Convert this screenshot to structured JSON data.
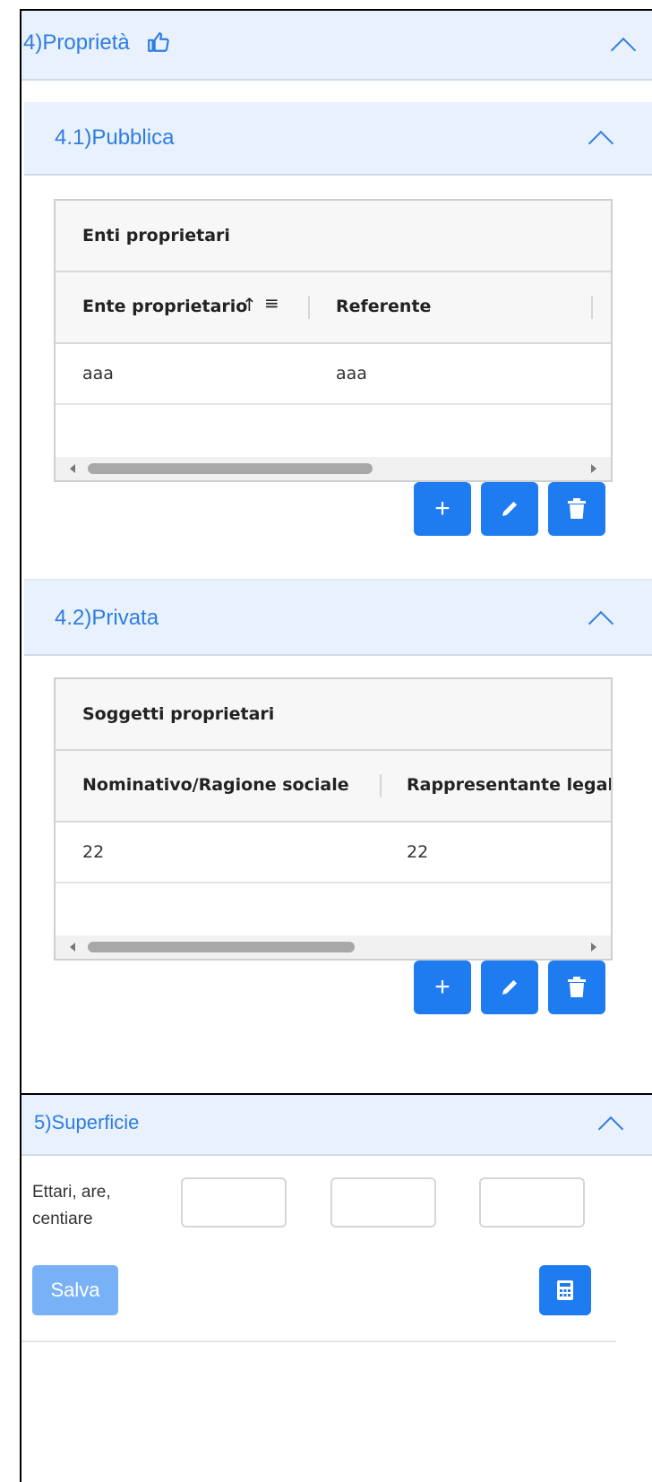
{
  "section4": {
    "title": "4)Proprietà",
    "icon": "thumbs-up-icon",
    "public": {
      "title": "4.1)Pubblica",
      "table": {
        "caption": "Enti proprietari",
        "columns": [
          "Ente proprietario",
          "Referente"
        ],
        "sort_icon": "↑",
        "menu_icon": "≡",
        "rows": [
          [
            "aaa",
            "aaa"
          ]
        ]
      }
    },
    "private": {
      "title": "4.2)Privata",
      "table": {
        "caption": "Soggetti proprietari",
        "columns": [
          "Nominativo/Ragione sociale",
          "Rappresentante legale"
        ],
        "rows": [
          [
            "22",
            "22"
          ]
        ]
      }
    },
    "actions": {
      "add": "+",
      "add_icon": "plus-icon",
      "edit_icon": "pencil-icon",
      "delete_icon": "trash-icon"
    }
  },
  "section5": {
    "title": "5)Superficie",
    "field_label_line1": "Ettari, are,",
    "field_label_line2": "centiare",
    "inputs": [
      "",
      "",
      ""
    ],
    "save_label": "Salva",
    "calc_icon": "calculator-icon"
  },
  "colors": {
    "primary": "#1e7bf0",
    "header_bg": "#e8f1fc",
    "title_blue": "#2f7de1",
    "disabled": "#79b1f7"
  }
}
